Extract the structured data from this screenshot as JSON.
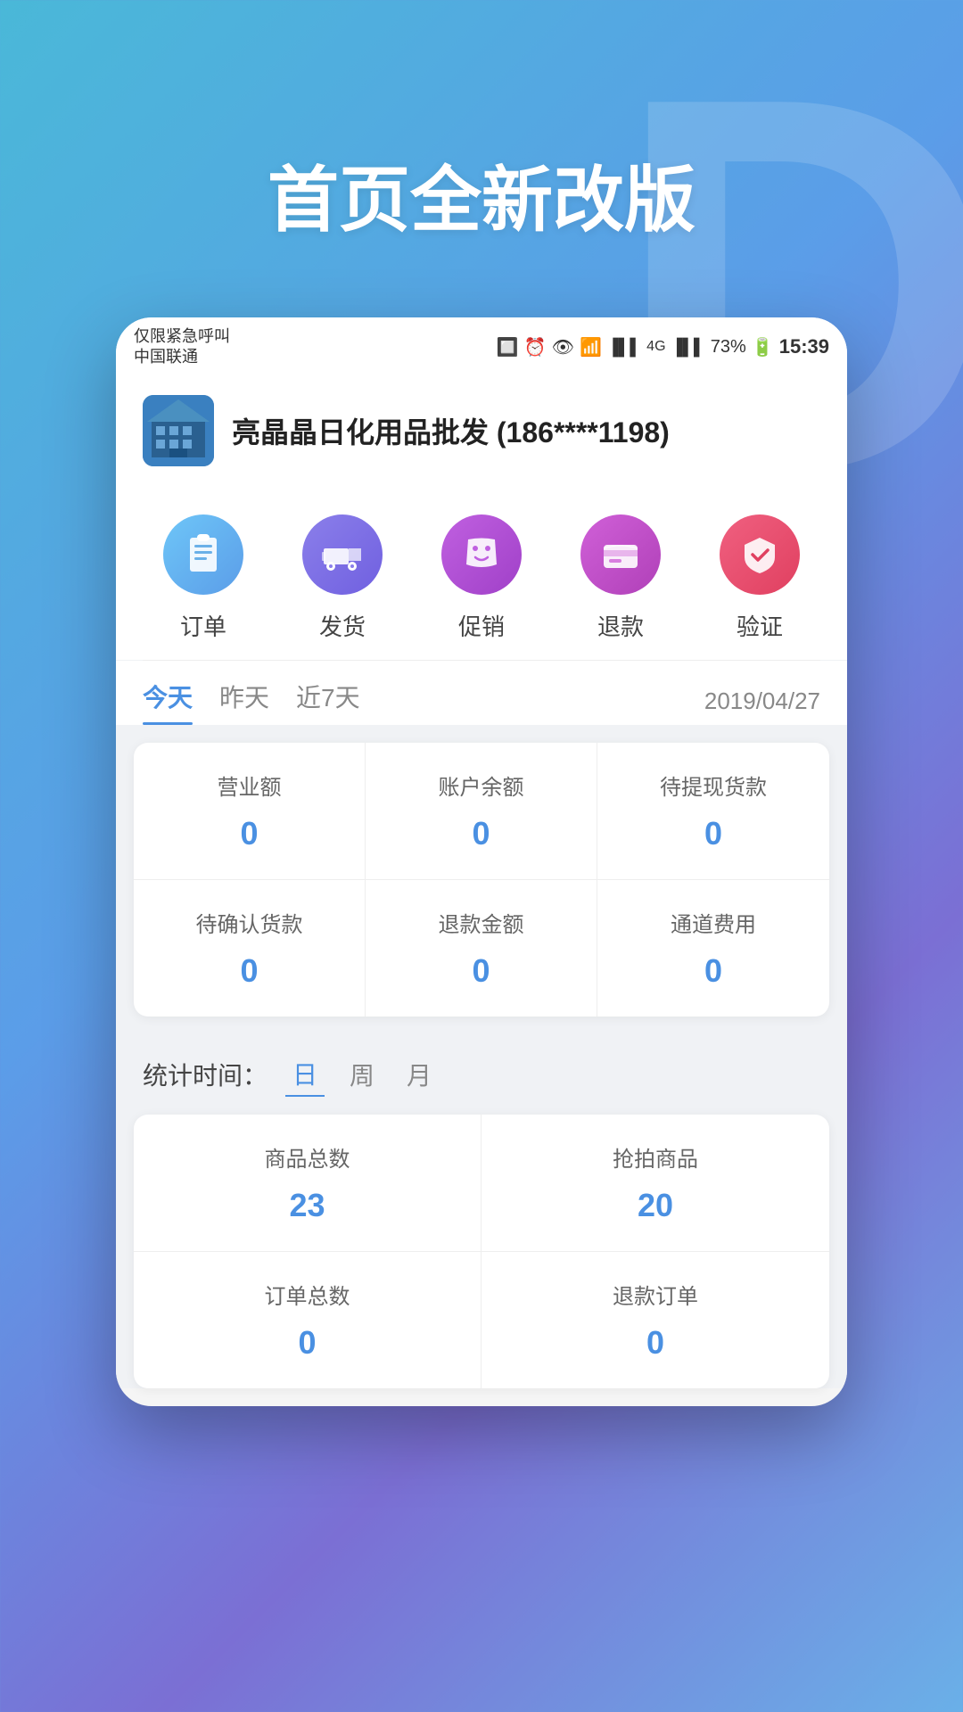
{
  "background": {
    "letter": "D"
  },
  "page_title": "首页全新改版",
  "status_bar": {
    "left_line1": "仅限紧急呼叫",
    "left_line2": "中国联通",
    "battery": "73%",
    "time": "15:39"
  },
  "header": {
    "shop_name": "亮晶晶日化用品批发 (186****1198)"
  },
  "quick_actions": [
    {
      "id": "order",
      "label": "订单",
      "icon": "📋"
    },
    {
      "id": "delivery",
      "label": "发货",
      "icon": "🚚"
    },
    {
      "id": "promo",
      "label": "促销",
      "icon": "🛍"
    },
    {
      "id": "refund",
      "label": "退款",
      "icon": "💳"
    },
    {
      "id": "verify",
      "label": "验证",
      "icon": "🛡"
    }
  ],
  "tabs": {
    "items": [
      {
        "label": "今天",
        "active": true
      },
      {
        "label": "昨天",
        "active": false
      },
      {
        "label": "近7天",
        "active": false
      }
    ],
    "date": "2019/04/27"
  },
  "stats_row1": [
    {
      "label": "营业额",
      "value": "0"
    },
    {
      "label": "账户余额",
      "value": "0"
    },
    {
      "label": "待提现货款",
      "value": "0"
    }
  ],
  "stats_row2": [
    {
      "label": "待确认货款",
      "value": "0"
    },
    {
      "label": "退款金额",
      "value": "0"
    },
    {
      "label": "通道费用",
      "value": "0"
    }
  ],
  "time_filter": {
    "label": "统计时间：",
    "options": [
      {
        "label": "日",
        "active": true
      },
      {
        "label": "周",
        "active": false
      },
      {
        "label": "月",
        "active": false
      }
    ]
  },
  "stats2_row1": [
    {
      "label": "商品总数",
      "value": "23"
    },
    {
      "label": "抢拍商品",
      "value": "20"
    }
  ],
  "stats2_row2": [
    {
      "label": "订单总数",
      "value": "0"
    },
    {
      "label": "退款订单",
      "value": "0"
    }
  ]
}
